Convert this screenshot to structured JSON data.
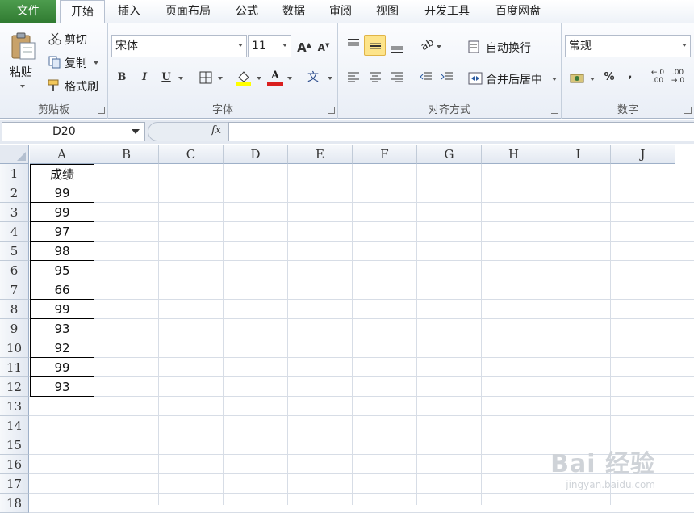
{
  "tabs": [
    "文件",
    "开始",
    "插入",
    "页面布局",
    "公式",
    "数据",
    "审阅",
    "视图",
    "开发工具",
    "百度网盘"
  ],
  "clipboard": {
    "paste": "粘贴",
    "cut": "剪切",
    "copy": "复制",
    "format_painter": "格式刷",
    "group": "剪贴板"
  },
  "font": {
    "name": "宋体",
    "size": "11",
    "bold": "B",
    "italic": "I",
    "underline": "U",
    "group": "字体",
    "font_color": "#d91f1f",
    "fill_color": "#ffff00"
  },
  "alignment": {
    "wrap_text": "自动换行",
    "merge_center": "合并后居中",
    "group": "对齐方式"
  },
  "number": {
    "format": "常规",
    "percent": "%",
    "comma": ",",
    "group": "数字"
  },
  "formula_bar": {
    "name_box": "D20",
    "fx": "fx",
    "value": ""
  },
  "sheet": {
    "columns": [
      "A",
      "B",
      "C",
      "D",
      "E",
      "F",
      "G",
      "H",
      "I",
      "J"
    ],
    "rows": [
      "1",
      "2",
      "3",
      "4",
      "5",
      "6",
      "7",
      "8",
      "9",
      "10",
      "11",
      "12",
      "13",
      "14",
      "15",
      "16",
      "17",
      "18"
    ],
    "column_a": [
      "成绩",
      "99",
      "99",
      "97",
      "98",
      "95",
      "66",
      "99",
      "93",
      "92",
      "99",
      "93"
    ]
  },
  "watermark": {
    "brand": "Bai 经验",
    "url": "jingyan.baidu.com"
  }
}
